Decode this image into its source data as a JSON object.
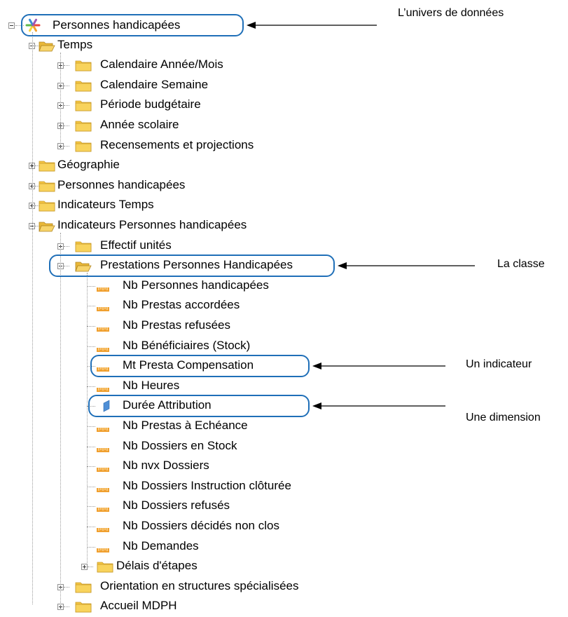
{
  "tree": {
    "root": {
      "label": "Personnes handicapées",
      "icon": "universe-icon"
    },
    "items": [
      {
        "id": "temps",
        "label": "Temps",
        "level": 1,
        "icon": "folder-open-icon",
        "expander": "minus"
      },
      {
        "id": "cal-annee-mois",
        "label": "Calendaire Année/Mois",
        "level": 2,
        "icon": "folder-icon",
        "expander": "plus"
      },
      {
        "id": "cal-semaine",
        "label": "Calendaire Semaine",
        "level": 2,
        "icon": "folder-icon",
        "expander": "plus"
      },
      {
        "id": "periode-budgetaire",
        "label": "Période budgétaire",
        "level": 2,
        "icon": "folder-icon",
        "expander": "plus"
      },
      {
        "id": "annee-scolaire",
        "label": "Année scolaire",
        "level": 2,
        "icon": "folder-icon",
        "expander": "plus"
      },
      {
        "id": "recensements",
        "label": "Recensements et projections",
        "level": 2,
        "icon": "folder-icon",
        "expander": "plus"
      },
      {
        "id": "geographie",
        "label": "Géographie",
        "level": 1,
        "icon": "folder-icon",
        "expander": "plus"
      },
      {
        "id": "personnes-handicapees",
        "label": "Personnes handicapées",
        "level": 1,
        "icon": "folder-icon",
        "expander": "plus"
      },
      {
        "id": "indicateurs-temps",
        "label": "Indicateurs Temps",
        "level": 1,
        "icon": "folder-icon",
        "expander": "plus"
      },
      {
        "id": "indicateurs-ph",
        "label": "Indicateurs Personnes handicapées",
        "level": 1,
        "icon": "folder-open-icon",
        "expander": "minus"
      },
      {
        "id": "effectif-unites",
        "label": "Effectif unités",
        "level": 2,
        "icon": "folder-icon",
        "expander": "plus"
      },
      {
        "id": "prestations-ph",
        "label": "Prestations Personnes Handicapées",
        "level": 2,
        "icon": "folder-open-icon",
        "expander": "minus"
      },
      {
        "id": "nb-personnes-handicapees",
        "label": "Nb Personnes handicapées",
        "level": 3,
        "icon": "measure-icon"
      },
      {
        "id": "nb-prestas-accordees",
        "label": "Nb Prestas accordées",
        "level": 3,
        "icon": "measure-icon"
      },
      {
        "id": "nb-prestas-refusees",
        "label": "Nb Prestas refusées",
        "level": 3,
        "icon": "measure-icon"
      },
      {
        "id": "nb-beneficiaires",
        "label": "Nb Bénéficiaires (Stock)",
        "level": 3,
        "icon": "measure-icon"
      },
      {
        "id": "mt-presta-compensation",
        "label": "Mt Presta Compensation",
        "level": 3,
        "icon": "measure-icon"
      },
      {
        "id": "nb-heures",
        "label": "Nb Heures",
        "level": 3,
        "icon": "measure-icon"
      },
      {
        "id": "duree-attribution",
        "label": "Durée Attribution",
        "level": 3,
        "icon": "dimension-icon"
      },
      {
        "id": "nb-prestas-echeance",
        "label": "Nb Prestas à Echéance",
        "level": 3,
        "icon": "measure-icon"
      },
      {
        "id": "nb-dossiers-stock",
        "label": "Nb Dossiers en Stock",
        "level": 3,
        "icon": "measure-icon"
      },
      {
        "id": "nb-nvx-dossiers",
        "label": "Nb nvx Dossiers",
        "level": 3,
        "icon": "measure-icon"
      },
      {
        "id": "nb-dossiers-instruction",
        "label": "Nb Dossiers Instruction clôturée",
        "level": 3,
        "icon": "measure-icon"
      },
      {
        "id": "nb-dossiers-refuses",
        "label": "Nb Dossiers refusés",
        "level": 3,
        "icon": "measure-icon"
      },
      {
        "id": "nb-dossiers-decides",
        "label": "Nb Dossiers décidés non clos",
        "level": 3,
        "icon": "measure-icon"
      },
      {
        "id": "nb-demandes",
        "label": "Nb Demandes",
        "level": 3,
        "icon": "measure-icon"
      },
      {
        "id": "delais-etapes",
        "label": "Délais d'étapes",
        "level": 3,
        "icon": "folder-icon",
        "expander": "plus"
      },
      {
        "id": "orientation",
        "label": "Orientation en structures spécialisées",
        "level": 2,
        "icon": "folder-icon",
        "expander": "plus"
      },
      {
        "id": "accueil-mdph",
        "label": "Accueil MDPH",
        "level": 2,
        "icon": "folder-icon",
        "expander": "plus"
      }
    ]
  },
  "annotations": {
    "univers": "L’univers de données",
    "classe": "La classe",
    "indicateur": "Un indicateur",
    "dimension": "Une dimension"
  },
  "colors": {
    "callout": "#1f6fb8",
    "folder": "#f5c542",
    "measure": "#f0a030",
    "dimension": "#4f8fd6"
  }
}
